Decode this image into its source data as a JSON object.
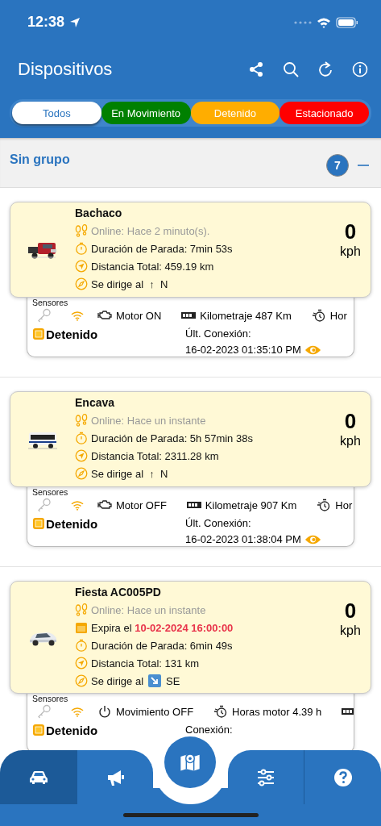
{
  "status_bar": {
    "time": "12:38"
  },
  "header": {
    "title": "Dispositivos",
    "actions": [
      {
        "kind": "share"
      },
      {
        "kind": "search"
      },
      {
        "kind": "refresh"
      },
      {
        "kind": "info"
      }
    ]
  },
  "filters": [
    {
      "label": "Todos",
      "color": "#ffffff",
      "selected": true
    },
    {
      "label": "En Movimiento",
      "color": "#008000",
      "selected": false
    },
    {
      "label": "Detenido",
      "color": "#ffad00",
      "selected": false
    },
    {
      "label": "Estacionado",
      "color": "#ff0000",
      "selected": false
    }
  ],
  "group": {
    "name": "Sin grupo",
    "count": "7",
    "expanded": true
  },
  "devices": [
    {
      "name": "Bachaco",
      "picture": {
        "kind": "picture"
      },
      "online": "Online: Hace 2 minuto(s).",
      "duration": "Duración de Parada: 7min 53s",
      "distance": "Distancia Total: 459.19 km",
      "heading": {
        "kind": "glyph",
        "label": "Se dirige al",
        "arrow": "↑",
        "dir": "N"
      },
      "speed": "0",
      "unit": "kph",
      "sensors_label": "Sensores",
      "sensors": [
        {
          "kind": "engine",
          "text": "Motor ON"
        },
        {
          "kind": "odometer",
          "text": "Kilometraje 487 Km"
        },
        {
          "kind": "hours",
          "text": "Hor"
        }
      ],
      "status": "Detenido",
      "conn_label": "Últ. Conexión:",
      "conn_date": "16-02-2023 01:35:10 PM"
    },
    {
      "name": "Encava",
      "picture": {
        "kind": "picture"
      },
      "online": "Online: Hace un instante",
      "duration": "Duración de Parada: 5h 57min 38s",
      "distance": "Distancia Total: 2311.28 km",
      "heading": {
        "kind": "glyph",
        "label": "Se dirige al",
        "arrow": "↑",
        "dir": "N"
      },
      "speed": "0",
      "unit": "kph",
      "sensors_label": "Sensores",
      "sensors": [
        {
          "kind": "engine",
          "text": "Motor OFF"
        },
        {
          "kind": "odometer",
          "text": "Kilometraje 907 Km"
        },
        {
          "kind": "hours",
          "text": "Hor"
        }
      ],
      "status": "Detenido",
      "conn_label": "Últ. Conexión:",
      "conn_date": "16-02-2023 01:38:04 PM"
    },
    {
      "name": "Fiesta AC005PD",
      "picture": {
        "kind": "picture"
      },
      "online": "Online: Hace un instante",
      "expiry": {
        "label": "Expira el",
        "date": "10-02-2024 16:00:00"
      },
      "duration": "Duración de Parada: 6min 49s",
      "distance": "Distancia Total: 131 km",
      "heading": {
        "kind": "badge",
        "label": "Se dirige al",
        "dir": "SE"
      },
      "speed": "0",
      "unit": "kph",
      "sensors_label": "Sensores",
      "sensors": [
        {
          "kind": "power",
          "text": "Movimiento OFF"
        },
        {
          "kind": "hours",
          "text": "Horas motor 4.39 h"
        },
        {
          "kind": "odometer"
        }
      ],
      "status": "Detenido",
      "conn_label": "Conexión:"
    }
  ],
  "bottom_nav": [
    {
      "kind": "car",
      "selected": true
    },
    {
      "kind": "megaphone",
      "selected": false
    },
    {
      "kind": "map",
      "selected": false
    },
    {
      "kind": "sliders",
      "selected": false
    },
    {
      "kind": "help",
      "selected": false
    }
  ]
}
